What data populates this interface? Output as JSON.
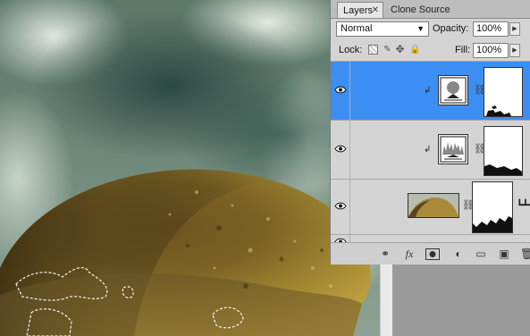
{
  "panel": {
    "tabs": [
      {
        "label": "Layers",
        "close": "✕"
      },
      {
        "label": "Clone Source"
      }
    ],
    "blend_mode": "Normal",
    "opacity_label": "Opacity:",
    "opacity_value": "100%",
    "lock_label": "Lock:",
    "fill_label": "Fill:",
    "fill_value": "100%"
  },
  "layers": [
    {
      "type": "adjustment-levels",
      "selected": true,
      "visible": true,
      "clipped": true
    },
    {
      "type": "adjustment-curves",
      "selected": false,
      "visible": true,
      "clipped": true
    },
    {
      "type": "image-with-mask",
      "selected": false,
      "visible": true,
      "clipped": false
    },
    {
      "type": "partial",
      "selected": false,
      "visible": true
    }
  ],
  "footer_icons": [
    "link-icon",
    "fx-icon",
    "add-mask-icon",
    "adjustment-layer-icon",
    "group-icon",
    "new-layer-icon",
    "trash-icon"
  ],
  "colors": {
    "selected_row": "#3d8ef2",
    "panel_bg": "#d4d4d4"
  }
}
